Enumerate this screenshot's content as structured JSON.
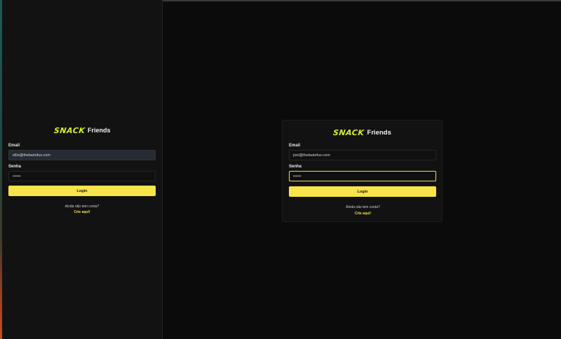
{
  "brand": {
    "mark": "SNACK",
    "word": "Friends"
  },
  "left": {
    "email_label": "Email",
    "email_value": "ellie@thelastofus.com",
    "password_label": "Senha",
    "password_value": "••••••",
    "login_label": "Login",
    "signup_prompt": "Ainda não tem conta?",
    "signup_link": "Crie aqui!"
  },
  "right": {
    "email_label": "Email",
    "email_value": "joel@thelastofus.com",
    "password_label": "Senha",
    "password_value": "••••••",
    "login_label": "Login",
    "signup_prompt": "Ainda não tem conta?",
    "signup_link": "Crie aqui!"
  },
  "colors": {
    "accent": "#f7e34a",
    "brand_mark": "#d9ec2e",
    "background": "#0b0b0b",
    "panel": "#121212"
  }
}
